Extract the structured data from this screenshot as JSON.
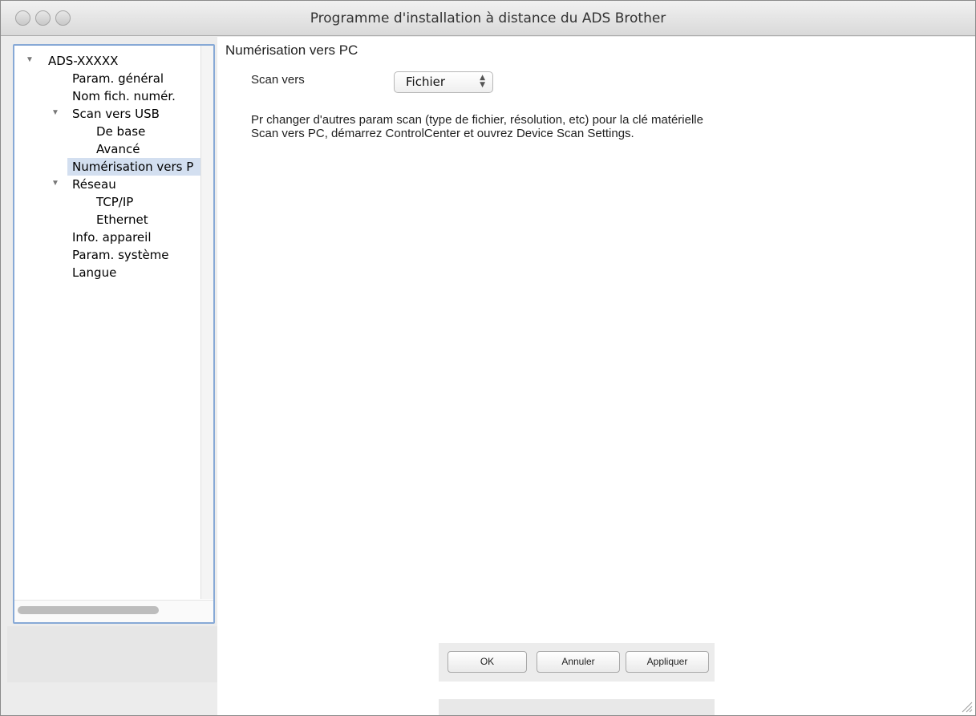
{
  "window": {
    "title": "Programme d'installation à distance du ADS Brother"
  },
  "sidebar": {
    "items": [
      {
        "label": "ADS-XXXXX",
        "level": 0,
        "expanded": true
      },
      {
        "label": "Param. général",
        "level": 1
      },
      {
        "label": "Nom fich. numér.",
        "level": 1
      },
      {
        "label": "Scan vers USB",
        "level": 1,
        "expanded": true
      },
      {
        "label": "De base",
        "level": 2
      },
      {
        "label": "Avancé",
        "level": 2
      },
      {
        "label": "Numérisation vers P",
        "level": 1,
        "selected": true
      },
      {
        "label": "Réseau",
        "level": 1,
        "expanded": true
      },
      {
        "label": "TCP/IP",
        "level": 2
      },
      {
        "label": "Ethernet",
        "level": 2
      },
      {
        "label": "Info. appareil",
        "level": 1
      },
      {
        "label": "Param. système",
        "level": 1
      },
      {
        "label": "Langue",
        "level": 1
      }
    ]
  },
  "main": {
    "section_title": "Numérisation vers PC",
    "scan_to_label": "Scan vers",
    "scan_to_value": "Fichier",
    "info_line1": "Pr changer d'autres param scan (type de fichier, résolution, etc) pour la clé matérielle",
    "info_line2": "Scan vers PC, démarrez ControlCenter et ouvrez Device Scan Settings."
  },
  "buttons": {
    "ok": "OK",
    "cancel": "Annuler",
    "apply": "Appliquer"
  },
  "colors": {
    "accent_border": "#87a9d6",
    "selection": "#d3dff0"
  }
}
